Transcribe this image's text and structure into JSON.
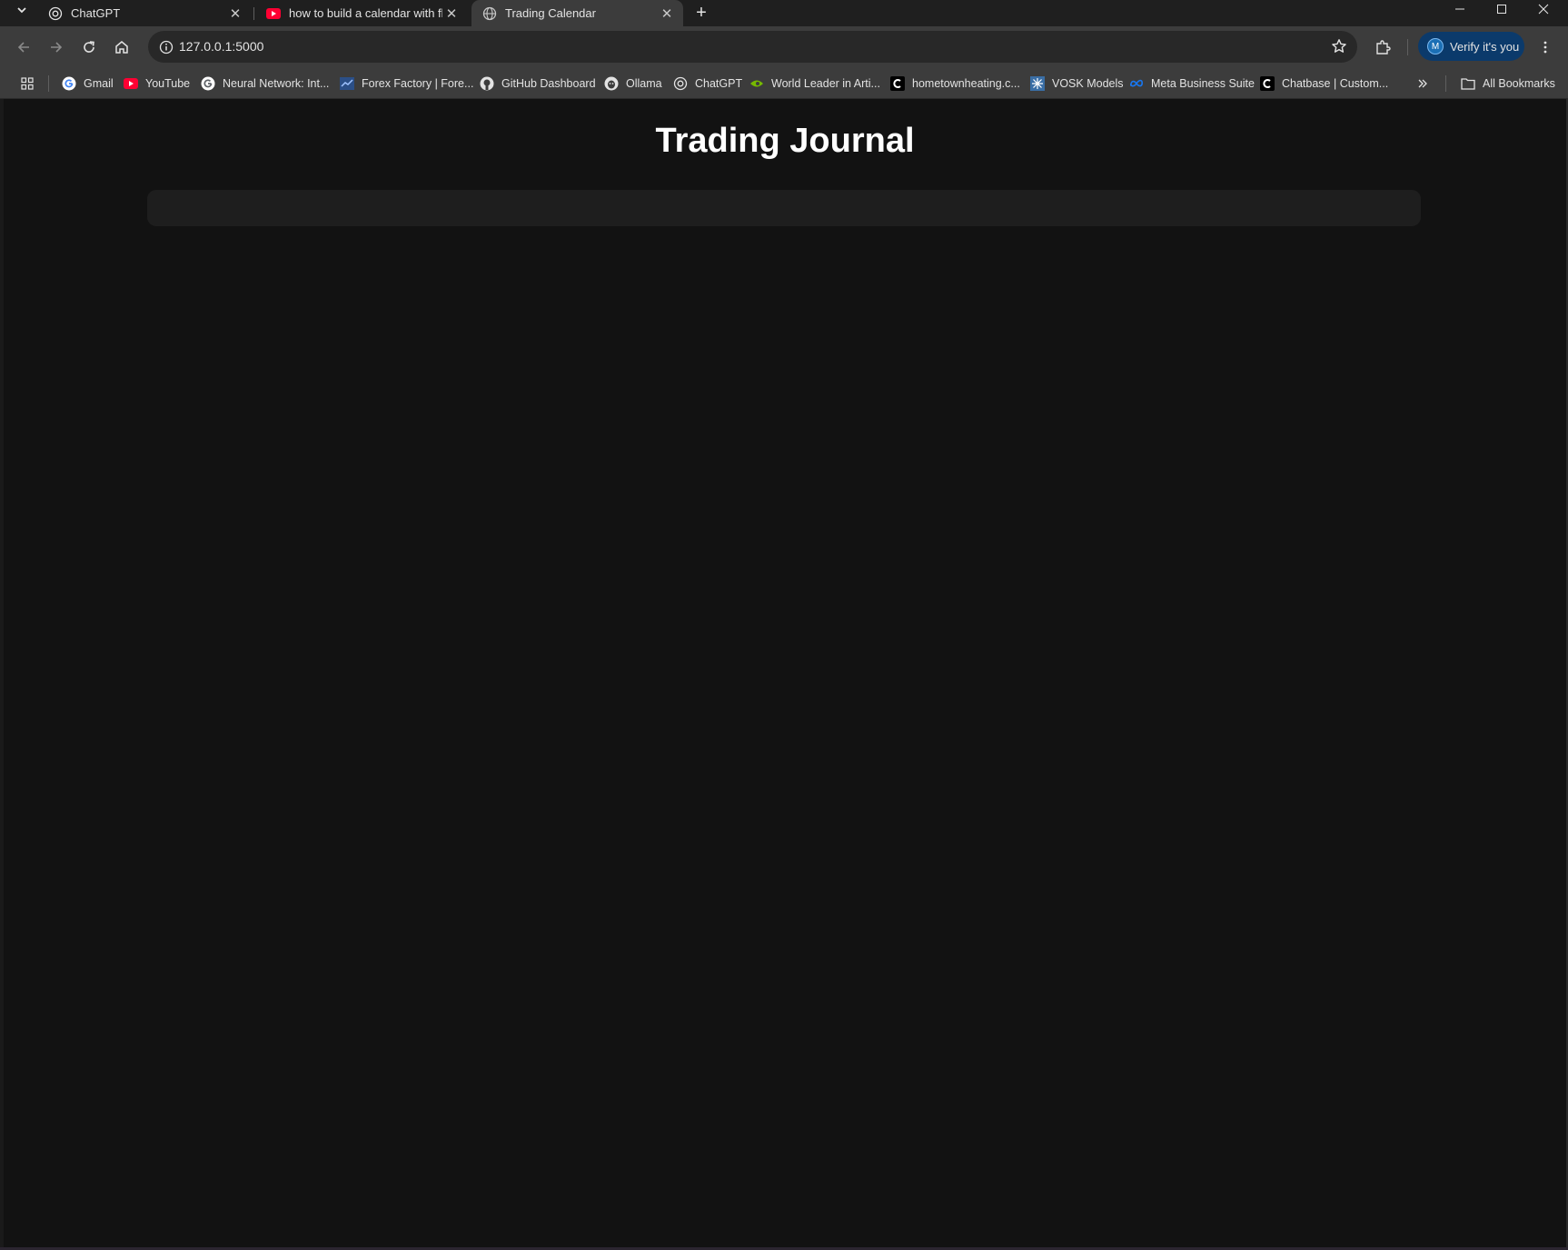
{
  "browser": {
    "tabs": [
      {
        "title": "ChatGPT",
        "icon": "chatgpt-icon",
        "active": false
      },
      {
        "title": "how to build a calendar with fla",
        "icon": "youtube-icon",
        "active": false
      },
      {
        "title": "Trading Calendar",
        "icon": "globe-icon",
        "active": true
      }
    ],
    "url": "127.0.0.1:5000",
    "verify_label": "Verify it's you",
    "avatar_letter": "M",
    "bookmarks": [
      {
        "label": "Gmail",
        "icon": "google-icon"
      },
      {
        "label": "YouTube",
        "icon": "youtube-icon"
      },
      {
        "label": "Neural Network: Int...",
        "icon": "google-icon"
      },
      {
        "label": "Forex Factory | Fore...",
        "icon": "forex-factory-icon"
      },
      {
        "label": "GitHub Dashboard",
        "icon": "github-icon"
      },
      {
        "label": "Ollama",
        "icon": "ollama-icon"
      },
      {
        "label": "ChatGPT",
        "icon": "chatgpt-icon"
      },
      {
        "label": "World Leader in Arti...",
        "icon": "nvidia-icon"
      },
      {
        "label": "hometownheating.c...",
        "icon": "c-logo-icon"
      },
      {
        "label": "VOSK Models",
        "icon": "vosk-icon"
      },
      {
        "label": "Meta Business Suite",
        "icon": "meta-icon"
      },
      {
        "label": "Chatbase | Custom...",
        "icon": "c-logo-icon"
      }
    ],
    "all_bookmarks_label": "All Bookmarks"
  },
  "page": {
    "title": "Trading Journal"
  },
  "colors": {
    "page_bg": "#121212",
    "panel_bg": "#1e1e1e",
    "chrome_bg": "#3c3c3c",
    "verify_bg": "#0b3a6b"
  }
}
